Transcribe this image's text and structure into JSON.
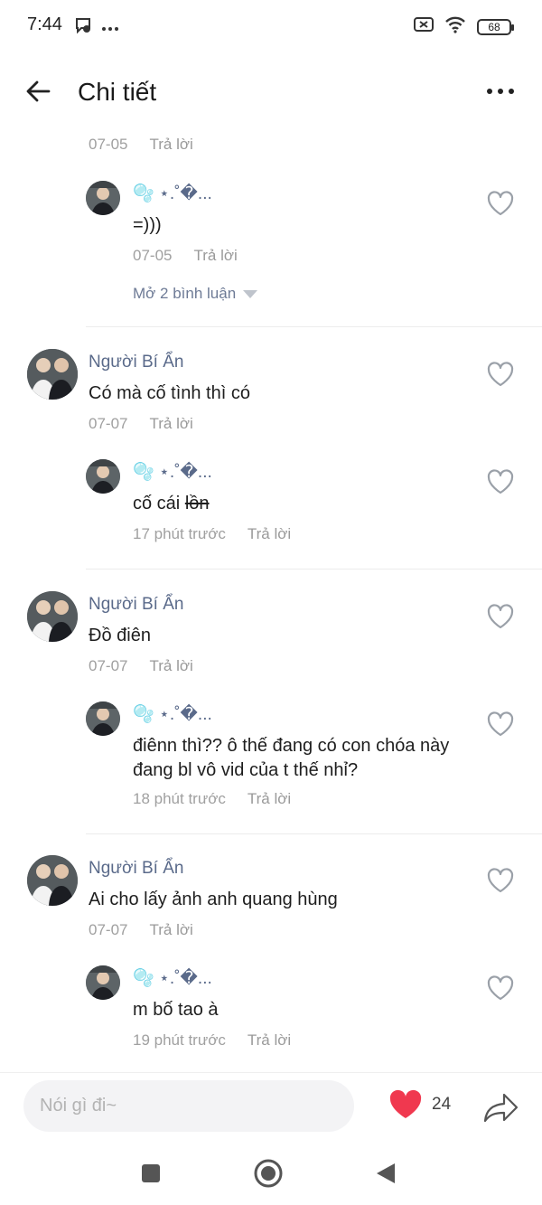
{
  "status_bar": {
    "time": "7:44",
    "battery": "68",
    "icons": [
      "messenger-icon",
      "more-dots-icon",
      "no-sim-icon",
      "wifi-icon",
      "battery-icon"
    ]
  },
  "header": {
    "title": "Chi tiết"
  },
  "comments": [
    {
      "id": "c0-tail",
      "date": "07-05",
      "reply_label": "Trả lời",
      "replies": [
        {
          "username": "🫧 ⋆.˚�...",
          "text": "=)))",
          "date": "07-05",
          "reply_label": "Trả lời"
        }
      ],
      "expand_label": "Mở 2 bình luận"
    },
    {
      "id": "c1",
      "username": "Người Bí Ẩn",
      "text": "Có mà cố tình thì có",
      "date": "07-07",
      "reply_label": "Trả lời",
      "replies": [
        {
          "username": "🫧 ⋆.˚�...",
          "text_plain": "cố cái ",
          "text_strike": "lồn",
          "date": "17 phút trước",
          "reply_label": "Trả lời"
        }
      ]
    },
    {
      "id": "c2",
      "username": "Người Bí Ẩn",
      "text": "Đồ điên",
      "date": "07-07",
      "reply_label": "Trả lời",
      "replies": [
        {
          "username": "🫧 ⋆.˚�...",
          "text_line1": "điênn thì?? ô thế đang có con chóa này",
          "text_line2": "đang bl vô vid của t thế nhỉ?",
          "date": "18 phút trước",
          "reply_label": "Trả lời"
        }
      ]
    },
    {
      "id": "c3",
      "username": "Người Bí Ẩn",
      "text": "Ai cho lấy ảnh anh quang hùng",
      "date": "07-07",
      "reply_label": "Trả lời",
      "replies": [
        {
          "username": "🫧 ⋆.˚�...",
          "text": "m bố tao à",
          "date": "19 phút trước",
          "reply_label": "Trả lời"
        }
      ]
    }
  ],
  "bottom_bar": {
    "input_placeholder": "Nói gì đi~",
    "like_count": "24",
    "like_color": "#f0384f"
  },
  "colors": {
    "username": "#5a6a8a",
    "meta": "#a0a0a0"
  }
}
